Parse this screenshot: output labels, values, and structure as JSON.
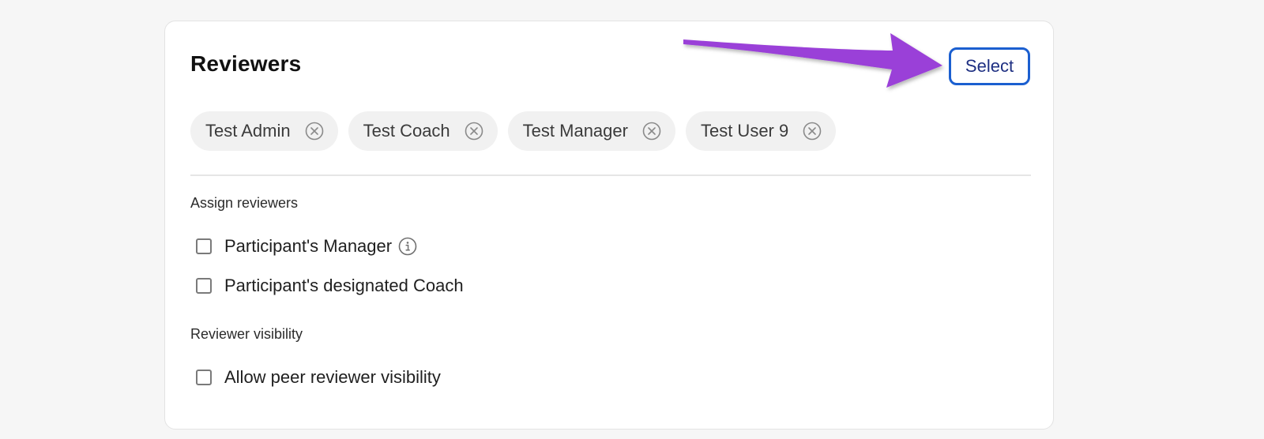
{
  "reviewers": {
    "title": "Reviewers",
    "select_label": "Select",
    "chips": [
      {
        "label": "Test Admin",
        "remove_icon": "close-circle-icon"
      },
      {
        "label": "Test Coach",
        "remove_icon": "close-circle-icon"
      },
      {
        "label": "Test Manager",
        "remove_icon": "close-circle-icon"
      },
      {
        "label": "Test User 9",
        "remove_icon": "close-circle-icon"
      }
    ]
  },
  "assign": {
    "label": "Assign reviewers",
    "options": [
      {
        "label": "Participant's Manager",
        "checked": false,
        "info_icon": "info-icon"
      },
      {
        "label": "Participant's designated Coach",
        "checked": false
      }
    ]
  },
  "visibility": {
    "label": "Reviewer visibility",
    "options": [
      {
        "label": "Allow peer reviewer visibility",
        "checked": false
      }
    ]
  },
  "colors": {
    "accent": "#1b5fd0",
    "select_text": "#1e2f82",
    "annotation_arrow": "#9a3fd8"
  }
}
